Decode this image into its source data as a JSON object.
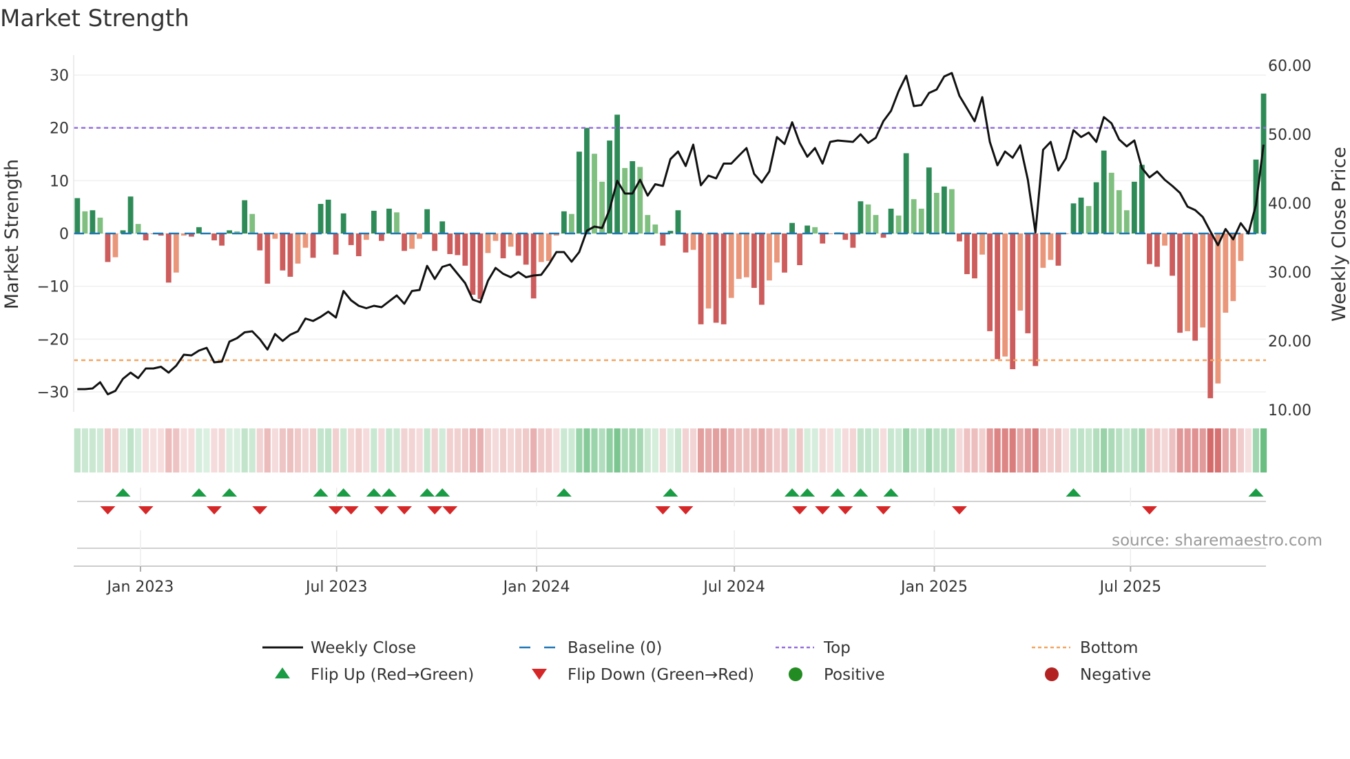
{
  "chart_data": {
    "type": "bar",
    "title": "Market Strength",
    "ylabel": "Market Strength",
    "y2label": "Weekly Close Price",
    "ylim": [
      -34,
      31.5
    ],
    "y2lim": [
      10,
      60
    ],
    "yticks": [
      "30",
      "20",
      "10",
      "0",
      "−10",
      "−20",
      "−30"
    ],
    "ytick_values": [
      30,
      20,
      10,
      0,
      -10,
      -20,
      -30
    ],
    "y2ticks": [
      "60.00",
      "50.00",
      "40.00",
      "30.00",
      "20.00",
      "10.00"
    ],
    "y2tick_values": [
      60,
      50,
      40,
      30,
      20,
      10
    ],
    "xticks": [
      {
        "label": "Jan 2023",
        "week": 8.3
      },
      {
        "label": "Jul 2023",
        "week": 34.1
      },
      {
        "label": "Jan 2024",
        "week": 60.4
      },
      {
        "label": "Jul 2024",
        "week": 86.4
      },
      {
        "label": "Jan 2025",
        "week": 112.7
      },
      {
        "label": "Jul 2025",
        "week": 138.5
      }
    ],
    "top_level": 20,
    "bottom_level": -24,
    "baseline": 0,
    "strength": [
      6.7,
      4.2,
      4.4,
      3.0,
      -5.4,
      -4.5,
      0.6,
      7.0,
      1.8,
      -1.3,
      -0.1,
      -0.4,
      -9.3,
      -7.4,
      -0.4,
      -0.6,
      1.2,
      0.1,
      -1.3,
      -2.3,
      0.6,
      0.4,
      6.3,
      3.7,
      -3.2,
      -9.5,
      -1.0,
      -7.0,
      -8.2,
      -5.7,
      -2.7,
      -4.6,
      5.6,
      6.4,
      -4.0,
      3.8,
      -2.2,
      -4.3,
      -1.2,
      4.3,
      -1.4,
      4.7,
      4.0,
      -3.3,
      -2.9,
      -1.0,
      4.6,
      -3.3,
      2.3,
      -3.9,
      -4.1,
      -6.1,
      -11.6,
      -12.4,
      -3.7,
      -1.4,
      -4.7,
      -2.5,
      -4.2,
      -5.9,
      -12.3,
      -5.4,
      -5.2,
      -0.4,
      4.2,
      3.7,
      15.5,
      20.0,
      15.1,
      9.8,
      17.6,
      22.5,
      12.4,
      13.7,
      12.6,
      3.5,
      1.7,
      -2.3,
      0.5,
      4.4,
      -3.6,
      -3.1,
      -17.2,
      -14.2,
      -16.9,
      -17.2,
      -12.2,
      -8.6,
      -8.3,
      -10.3,
      -13.5,
      -8.9,
      -5.5,
      -7.4,
      2.0,
      -6.0,
      1.5,
      1.2,
      -1.9,
      -0.1,
      0.2,
      -1.2,
      -2.7,
      6.1,
      5.5,
      3.5,
      -0.8,
      4.7,
      3.4,
      15.2,
      6.5,
      4.7,
      12.5,
      7.7,
      8.9,
      8.4,
      -1.5,
      -7.7,
      -8.5,
      -4.0,
      -18.5,
      -23.8,
      -23.3,
      -25.7,
      -14.6,
      -18.9,
      -25.1,
      -6.5,
      -5.0,
      -6.1,
      -0.1,
      5.7,
      6.8,
      5.2,
      9.7,
      15.7,
      11.5,
      8.2,
      4.4,
      9.8,
      13.0,
      -5.8,
      -6.3,
      -2.3,
      -8.0,
      -18.8,
      -18.5,
      -20.3,
      -17.8,
      -31.2,
      -28.4,
      -15.0,
      -12.8,
      -5.2,
      -0.1,
      14.0,
      26.5
    ],
    "weekly_close": [
      13.0,
      13.0,
      13.1,
      14.0,
      12.25,
      12.75,
      14.5,
      15.4,
      14.6,
      16.0,
      16.0,
      16.25,
      15.4,
      16.4,
      18.0,
      17.9,
      18.6,
      19.0,
      16.9,
      17.0,
      19.9,
      20.4,
      21.25,
      21.4,
      20.25,
      18.75,
      21.0,
      20.0,
      20.9,
      21.4,
      23.25,
      22.9,
      23.5,
      24.25,
      23.4,
      27.25,
      25.9,
      25.1,
      24.75,
      25.1,
      24.9,
      25.75,
      26.6,
      25.4,
      27.25,
      27.4,
      30.9,
      29.0,
      30.75,
      31.1,
      29.75,
      28.4,
      26.0,
      25.6,
      28.75,
      30.6,
      29.75,
      29.25,
      30.0,
      29.25,
      29.5,
      29.6,
      31.1,
      32.9,
      32.9,
      31.5,
      32.9,
      36.0,
      36.6,
      36.4,
      39.1,
      43.25,
      41.4,
      41.4,
      43.4,
      41.1,
      42.75,
      42.5,
      46.4,
      47.5,
      45.4,
      48.5,
      42.6,
      44.0,
      43.6,
      45.75,
      45.75,
      46.9,
      48.0,
      44.25,
      43.0,
      44.6,
      49.6,
      48.6,
      51.75,
      48.75,
      46.75,
      48.0,
      45.75,
      48.9,
      49.1,
      49.0,
      48.9,
      50.0,
      48.75,
      49.5,
      51.9,
      53.4,
      56.25,
      58.5,
      54.1,
      54.25,
      56.0,
      56.5,
      58.4,
      58.9,
      55.6,
      53.75,
      51.9,
      55.4,
      48.9,
      45.5,
      47.5,
      46.6,
      48.4,
      43.4,
      35.75,
      47.75,
      48.9,
      44.75,
      46.5,
      50.6,
      49.6,
      50.25,
      48.9,
      52.5,
      51.6,
      49.25,
      48.25,
      49.1,
      45.1,
      43.75,
      44.6,
      43.4,
      42.5,
      41.5,
      39.5,
      39.0,
      38.0,
      35.9,
      33.9,
      36.25,
      34.75,
      37.1,
      35.6,
      39.75,
      48.5
    ],
    "flip_up_weeks": [
      6,
      16,
      20,
      32,
      35,
      39,
      41,
      46,
      48,
      64,
      78,
      94,
      96,
      100,
      103,
      107,
      131,
      155
    ],
    "flip_down_weeks": [
      4,
      9,
      18,
      24,
      34,
      36,
      40,
      43,
      47,
      49,
      77,
      80,
      95,
      98,
      101,
      106,
      116,
      141
    ],
    "legend": [
      {
        "label": "Weekly Close",
        "symbol": "line"
      },
      {
        "label": "Baseline (0)",
        "symbol": "dash"
      },
      {
        "label": "Top",
        "symbol": "dot-purple"
      },
      {
        "label": "Bottom",
        "symbol": "dot-orange"
      },
      {
        "label": "Flip Up (Red→Green)",
        "symbol": "triangle-up"
      },
      {
        "label": "Flip Down (Green→Red)",
        "symbol": "triangle-down"
      },
      {
        "label": "Positive",
        "symbol": "circle-green"
      },
      {
        "label": "Negative",
        "symbol": "circle-red"
      }
    ],
    "legend_placement": "bottom-center",
    "grid": true,
    "source": "source: sharemaestro.com"
  },
  "colors": {
    "pos_strong": "#2e8b57",
    "pos_weak": "#7fbf7f",
    "neg_strong": "#cd5c5c",
    "neg_weak": "#e9967a",
    "price": "#111111",
    "baseline": "#1f77b4",
    "top": "#9370db",
    "bottom": "#f4a460",
    "flip_up": "#1a9c45",
    "flip_down": "#d62728",
    "positive": "#228b22",
    "negative": "#b22222"
  }
}
